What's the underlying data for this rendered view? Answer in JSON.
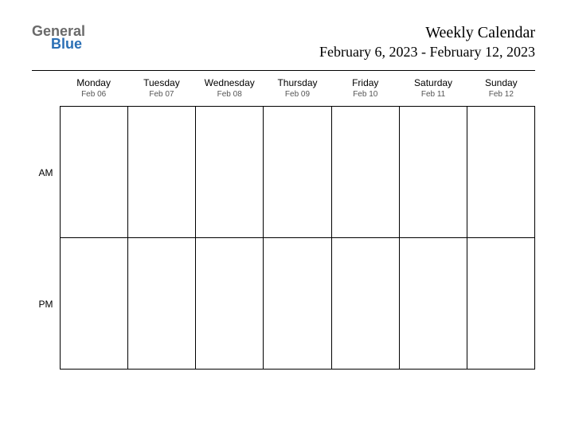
{
  "logo": {
    "part1": "General",
    "part2": "Blue"
  },
  "header": {
    "title": "Weekly Calendar",
    "date_range": "February 6, 2023 - February 12, 2023"
  },
  "time_labels": {
    "am": "AM",
    "pm": "PM"
  },
  "days": [
    {
      "name": "Monday",
      "date": "Feb 06"
    },
    {
      "name": "Tuesday",
      "date": "Feb 07"
    },
    {
      "name": "Wednesday",
      "date": "Feb 08"
    },
    {
      "name": "Thursday",
      "date": "Feb 09"
    },
    {
      "name": "Friday",
      "date": "Feb 10"
    },
    {
      "name": "Saturday",
      "date": "Feb 11"
    },
    {
      "name": "Sunday",
      "date": "Feb 12"
    }
  ]
}
